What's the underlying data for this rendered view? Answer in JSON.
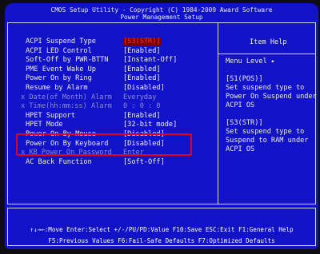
{
  "header": {
    "title": "CMOS Setup Utility - Copyright (C) 1984-2009 Award Software",
    "subtitle": "Power Management Setup"
  },
  "settings": [
    {
      "label": "ACPI Suspend Type",
      "value": "[S3(STR)]",
      "state": "selected"
    },
    {
      "label": "ACPI LED Control",
      "value": "[Enabled]",
      "state": "normal"
    },
    {
      "label": "Soft-Off by PWR-BTTN",
      "value": "[Instant-Off]",
      "state": "normal"
    },
    {
      "label": "PME Event Wake Up",
      "value": "[Enabled]",
      "state": "normal"
    },
    {
      "label": "Power On by Ring",
      "value": "[Enabled]",
      "state": "normal"
    },
    {
      "label": "Resume by Alarm",
      "value": "[Disabled]",
      "state": "normal"
    },
    {
      "label": "x  Date(of Month) Alarm",
      "value": "Everyday",
      "state": "disabled"
    },
    {
      "label": "x  Time(hh:mm:ss) Alarm",
      "value": "0 : 0 : 0",
      "state": "disabled"
    },
    {
      "label": "HPET Support",
      "value": "[Enabled]",
      "state": "normal"
    },
    {
      "label": "HPET Mode",
      "value": "[32-bit mode]",
      "state": "normal"
    },
    {
      "label": "Power On By Mouse",
      "value": "[Disabled]",
      "state": "normal"
    },
    {
      "label": "Power On By Keyboard",
      "value": "[Disabled]",
      "state": "normal"
    },
    {
      "label": "x  KB Power On Password",
      "value": "Enter",
      "state": "disabled"
    },
    {
      "label": "AC Back Function",
      "value": "[Soft-Off]",
      "state": "normal"
    }
  ],
  "help": {
    "title": "Item Help",
    "menu_level": "Menu Level   ▸",
    "lines": [
      "[S1(POS)]",
      "Set suspend type to",
      "Power On Suspend under",
      "ACPI OS",
      "",
      "[S3(STR)]",
      "Set suspend type to",
      "Suspend to RAM under",
      "ACPI OS"
    ]
  },
  "footer": {
    "line1": "↑↓→←:Move  Enter:Select  +/-/PU/PD:Value  F10:Save  ESC:Exit  F1:General Help",
    "line2": "F5:Previous Values  F6:Fail-Safe Defaults  F7:Optimized Defaults"
  },
  "colors": {
    "background": "#1212c8",
    "selected_text": "#ff3030",
    "highlight_box": "#e00020"
  }
}
